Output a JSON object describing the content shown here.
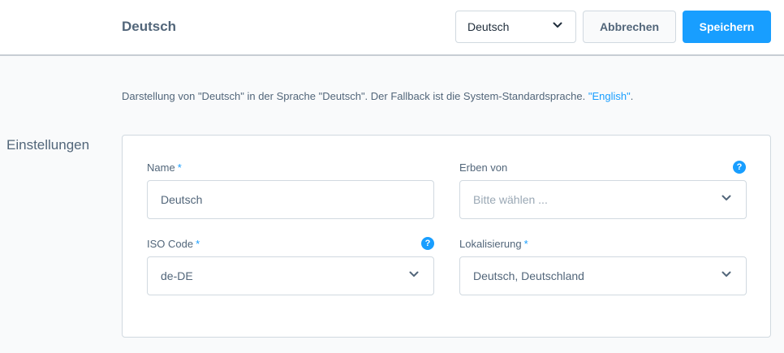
{
  "header": {
    "title": "Deutsch",
    "language_select": {
      "value": "Deutsch"
    },
    "cancel_label": "Abbrechen",
    "save_label": "Speichern"
  },
  "description": {
    "text": "Darstellung von \"Deutsch\" in der Sprache \"Deutsch\". Der Fallback ist die System-Standardsprache. ",
    "fallback_link": "\"English\"",
    "suffix": "."
  },
  "settings": {
    "title": "Einstellungen",
    "fields": {
      "name": {
        "label": "Name",
        "required_mark": "*",
        "value": "Deutsch"
      },
      "inherit": {
        "label": "Erben von",
        "placeholder": "Bitte wählen ..."
      },
      "iso_code": {
        "label": "ISO Code",
        "required_mark": "*",
        "value": "de-DE"
      },
      "locale": {
        "label": "Lokalisierung",
        "required_mark": "*",
        "value": "Deutsch, Deutschland"
      }
    },
    "help_glyph": "?"
  },
  "colors": {
    "accent": "#189eff",
    "text": "#52667a",
    "border": "#d1d9e0",
    "background": "#f9fafb"
  },
  "icons": {
    "dropdown": "chevron-down-icon",
    "help": "help-icon"
  }
}
